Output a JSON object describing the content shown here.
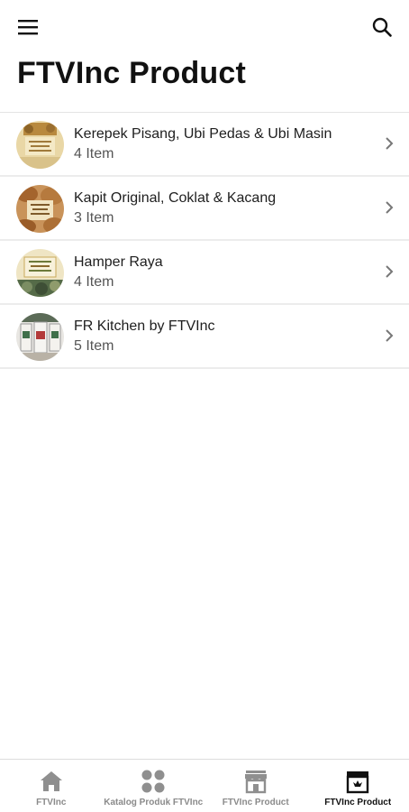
{
  "header": {
    "menu_icon": "hamburger-menu-icon",
    "search_icon": "search-icon",
    "title": "FTVInc Product"
  },
  "categories": [
    {
      "title": "Kerepek Pisang, Ubi Pedas & Ubi Masin",
      "count": "4 Item"
    },
    {
      "title": "Kapit Original, Coklat & Kacang",
      "count": "3 Item"
    },
    {
      "title": "Hamper Raya",
      "count": "4 Item"
    },
    {
      "title": "FR Kitchen by FTVInc",
      "count": "5 Item"
    }
  ],
  "bottom_nav": {
    "items": [
      {
        "label": "FTVInc",
        "icon": "home-icon",
        "active": false
      },
      {
        "label": "Katalog Produk FTVInc",
        "icon": "grid-dots-icon",
        "active": false
      },
      {
        "label": "FTVInc Product",
        "icon": "store-icon",
        "active": false
      },
      {
        "label": "FTVInc Product",
        "icon": "store-icon",
        "active": true
      }
    ]
  }
}
